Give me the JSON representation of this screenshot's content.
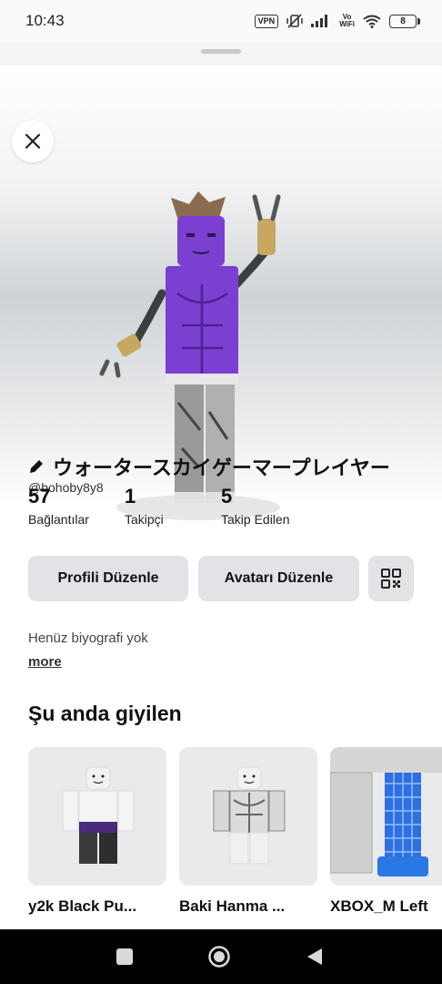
{
  "status_bar": {
    "time": "10:43",
    "vpn_label": "VPN",
    "vowifi_label_top": "Vo",
    "vowifi_label_bottom": "WiFi",
    "battery_level": "8",
    "icons": [
      "vpn-icon",
      "vibrate-off-icon",
      "signal-icon",
      "vowifi-icon",
      "wifi-icon",
      "battery-icon"
    ]
  },
  "profile": {
    "display_name": "ウォータースカイゲーマープレイヤー",
    "username": "@bohoby8y8",
    "stats": [
      {
        "value": "57",
        "label": "Bağlantılar"
      },
      {
        "value": "1",
        "label": "Takipçi"
      },
      {
        "value": "5",
        "label": "Takip Edilen"
      }
    ]
  },
  "actions": {
    "edit_profile": "Profili Düzenle",
    "edit_avatar": "Avatarı Düzenle",
    "qr_icon": "qr-code-icon"
  },
  "bio": {
    "text": "Henüz biyografi yok",
    "more_label": "more"
  },
  "wearing": {
    "title": "Şu anda giyilen",
    "items": [
      {
        "name": "y2k Black Pu..."
      },
      {
        "name": "Baki Hanma ..."
      },
      {
        "name": "XBOX_M Left"
      }
    ]
  },
  "colors": {
    "button_bg": "#e2e3e6",
    "avatar_purple": "#7b3fd1"
  }
}
